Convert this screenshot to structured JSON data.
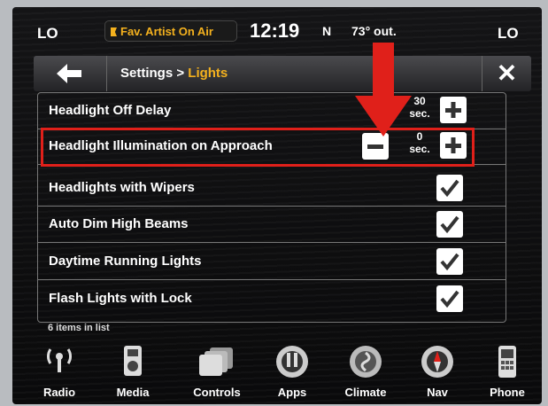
{
  "status": {
    "left_temp": "LO",
    "right_temp": "LO",
    "fav_button": "Fav. Artist On Air",
    "clock": "12:19",
    "compass": "N",
    "outside_temp": "73° out."
  },
  "header": {
    "breadcrumb_parent": "Settings > ",
    "breadcrumb_current": "Lights"
  },
  "settings": [
    {
      "label": "Headlight Off Delay",
      "value": "30\nsec."
    },
    {
      "label": "Headlight Illumination on Approach",
      "value": "0\nsec."
    },
    {
      "label": "Headlights with Wipers"
    },
    {
      "label": "Auto Dim High Beams"
    },
    {
      "label": "Daytime Running Lights"
    },
    {
      "label": "Flash Lights with Lock"
    }
  ],
  "list_count": "6 items in list",
  "dock": [
    {
      "label": "Radio",
      "icon": "radio-icon"
    },
    {
      "label": "Media",
      "icon": "media-icon"
    },
    {
      "label": "Controls",
      "icon": "controls-icon"
    },
    {
      "label": "Apps",
      "icon": "apps-icon"
    },
    {
      "label": "Climate",
      "icon": "climate-icon"
    },
    {
      "label": "Nav",
      "icon": "nav-icon"
    },
    {
      "label": "Phone",
      "icon": "phone-icon"
    }
  ],
  "colors": {
    "accent": "#f4b11e",
    "highlight": "#e0201a"
  }
}
